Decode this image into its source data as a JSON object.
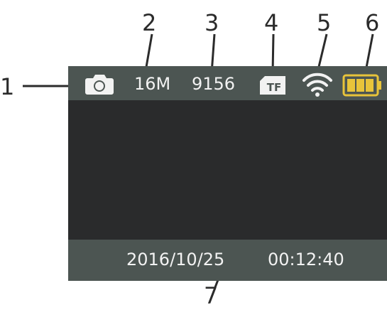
{
  "callouts": [
    "1",
    "2",
    "3",
    "4",
    "5",
    "6",
    "7"
  ],
  "status_bar": {
    "mode_icon": "camera-mode-icon",
    "resolution": "16M",
    "shots_remaining": "9156",
    "storage_icon": "tf-card-icon",
    "storage_label": "TF",
    "wifi_icon": "wifi-icon",
    "battery_icon": "battery-icon"
  },
  "bottom_bar": {
    "date": "2016/10/25",
    "time": "00:12:40"
  },
  "colors": {
    "bar": "#4c5552",
    "screen": "#2a2b2c",
    "text": "#f2f2f2",
    "battery": "#e8c43a"
  }
}
